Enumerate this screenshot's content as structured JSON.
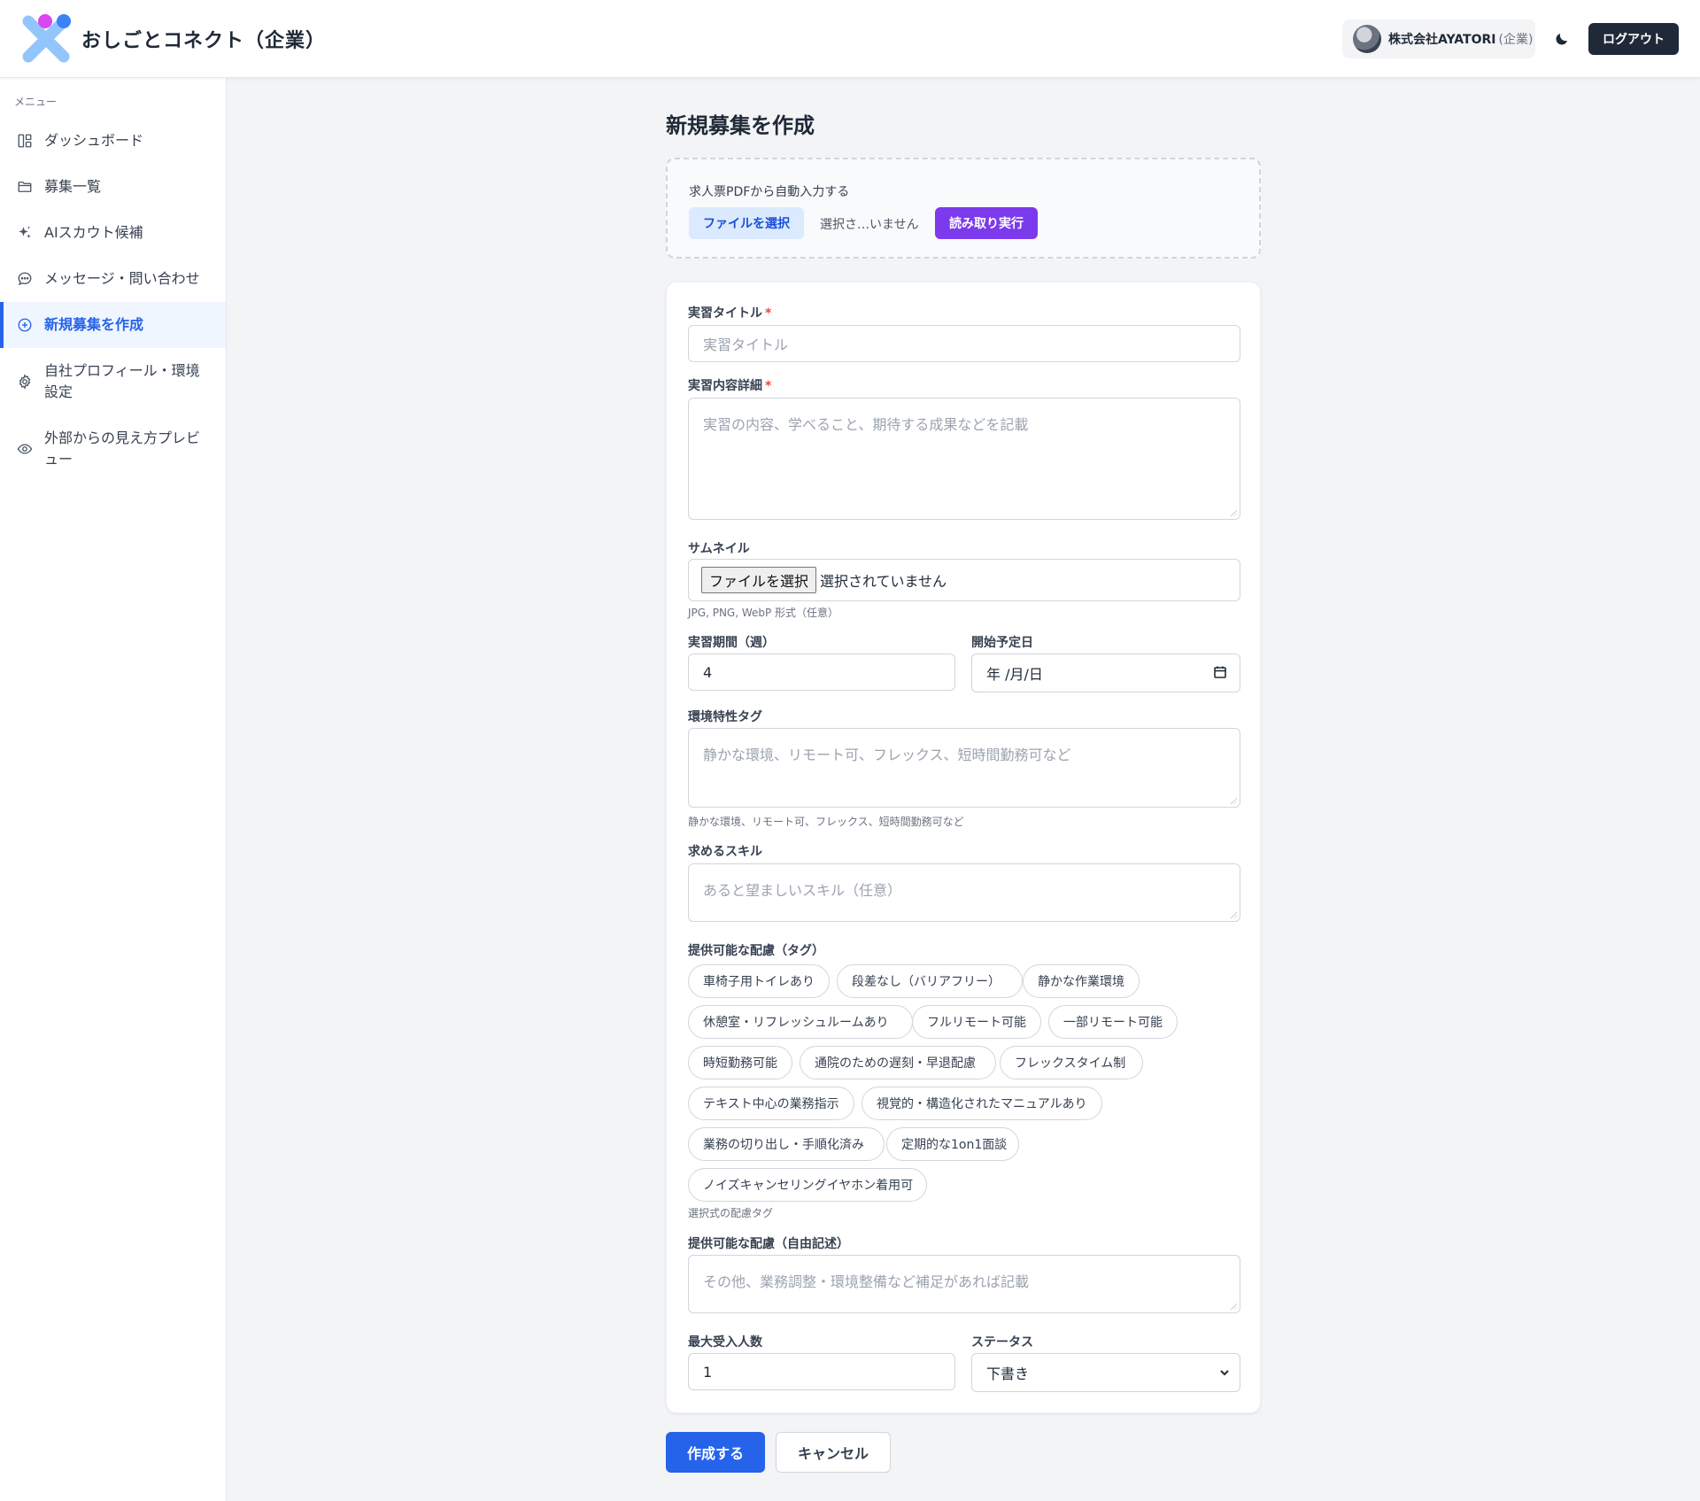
{
  "header": {
    "app_title": "おしごとコネクト（企業）",
    "company_name": "株式会社AYATORI",
    "company_role": "(企業)",
    "logout_label": "ログアウト"
  },
  "sidebar": {
    "heading": "メニュー",
    "items": [
      {
        "label": "ダッシュボード",
        "icon": "dashboard-icon"
      },
      {
        "label": "募集一覧",
        "icon": "folder-icon"
      },
      {
        "label": "AIスカウト候補",
        "icon": "sparkle-icon"
      },
      {
        "label": "メッセージ・問い合わせ",
        "icon": "chat-icon"
      },
      {
        "label": "新規募集を作成",
        "icon": "plus-circle-icon",
        "active": true
      },
      {
        "label": "自社プロフィール・環境設定",
        "icon": "gear-icon"
      },
      {
        "label": "外部からの見え方プレビュー",
        "icon": "eye-icon"
      }
    ]
  },
  "page": {
    "title": "新規募集を作成"
  },
  "pdf_import": {
    "label": "求人票PDFから自動入力する",
    "file_button": "ファイルを選択",
    "file_status": "選択さ…いません",
    "read_button": "読み取り実行"
  },
  "form": {
    "title_label": "実習タイトル",
    "required_mark": "*",
    "title_placeholder": "実習タイトル",
    "detail_label": "実習内容詳細",
    "detail_placeholder": "実習の内容、学べること、期待する成果などを記載",
    "thumbnail_label": "サムネイル",
    "thumbnail_button": "ファイルを選択",
    "thumbnail_status": "選択されていません",
    "thumbnail_hint": "JPG, PNG, WebP 形式（任意）",
    "duration_label": "実習期間（週）",
    "duration_value": "4",
    "start_label": "開始予定日",
    "start_value": "年 /月/日",
    "env_tags_label": "環境特性タグ",
    "env_tags_placeholder": "静かな環境、リモート可、フレックス、短時間勤務可など",
    "env_tags_hint": "静かな環境、リモート可、フレックス、短時間勤務可など",
    "skills_label": "求めるスキル",
    "skills_placeholder": "あると望ましいスキル（任意）",
    "accommodation_label": "提供可能な配慮（タグ）",
    "accommodation_tags": [
      "車椅子用トイレあり",
      "段差なし（バリアフリー）",
      "静かな作業環境",
      "休憩室・リフレッシュルームあり",
      "フルリモート可能",
      "一部リモート可能",
      "時短勤務可能",
      "通院のための遅刻・早退配慮",
      "フレックスタイム制",
      "テキスト中心の業務指示",
      "視覚的・構造化されたマニュアルあり",
      "業務の切り出し・手順化済み",
      "定期的な1on1面談",
      "ノイズキャンセリングイヤホン着用可"
    ],
    "accommodation_hint": "選択式の配慮タグ",
    "accommodation_free_label": "提供可能な配慮（自由記述）",
    "accommodation_free_placeholder": "その他、業務調整・環境整備など補足があれば記載",
    "capacity_label": "最大受入人数",
    "capacity_value": "1",
    "status_label": "ステータス",
    "status_value": "下書き"
  },
  "actions": {
    "submit_label": "作成する",
    "cancel_label": "キャンセル"
  },
  "colors": {
    "primary": "#2563eb",
    "purple": "#7c3aed",
    "dark": "#1f2937"
  }
}
